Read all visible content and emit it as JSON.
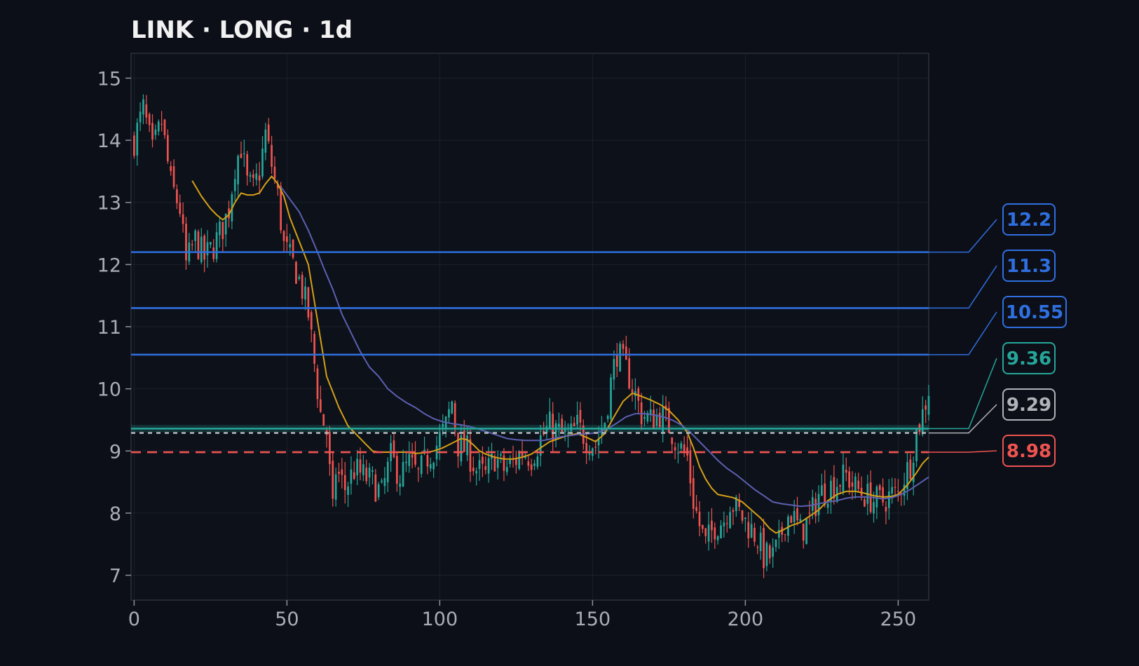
{
  "chart_data": {
    "type": "candlestick",
    "title": "LINK · LONG · 1d",
    "xlim": [
      -1,
      260
    ],
    "ylim": [
      6.6,
      15.4
    ],
    "x_ticks": [
      0,
      50,
      100,
      150,
      200,
      250
    ],
    "y_ticks": [
      7,
      8,
      9,
      10,
      11,
      12,
      13,
      14,
      15
    ],
    "grid": true,
    "colors": {
      "background": "#0c0f17",
      "plot_bg": "#0d1119",
      "up": "#26a69a",
      "down": "#ef5350",
      "ma_fast": "#d4a017",
      "ma_slow": "#5c5fb0",
      "target": "#2f6fe0",
      "entry": "#26a69a",
      "current": "#b0b3b8",
      "stop": "#ef5350"
    },
    "series": [
      {
        "name": "price",
        "close_path": [
          [
            0,
            14.0
          ],
          [
            3,
            14.5
          ],
          [
            6,
            13.8
          ],
          [
            9,
            14.3
          ],
          [
            12,
            13.3
          ],
          [
            15,
            12.9
          ],
          [
            17,
            12.0
          ],
          [
            20,
            12.4
          ],
          [
            23,
            12.1
          ],
          [
            26,
            12.3
          ],
          [
            29,
            12.6
          ],
          [
            31,
            12.9
          ],
          [
            33,
            13.6
          ],
          [
            35,
            13.9
          ],
          [
            37,
            13.3
          ],
          [
            39,
            13.2
          ],
          [
            41,
            13.5
          ],
          [
            43,
            14.1
          ],
          [
            45,
            13.6
          ],
          [
            47,
            13.1
          ],
          [
            49,
            12.3
          ],
          [
            51,
            12.1
          ],
          [
            53,
            11.9
          ],
          [
            55,
            11.6
          ],
          [
            57,
            11.2
          ],
          [
            59,
            10.4
          ],
          [
            61,
            9.6
          ],
          [
            63,
            9.3
          ],
          [
            65,
            8.0
          ],
          [
            66,
            8.7
          ],
          [
            69,
            8.4
          ],
          [
            72,
            8.7
          ],
          [
            75,
            8.6
          ],
          [
            78,
            8.5
          ],
          [
            81,
            8.3
          ],
          [
            84,
            8.9
          ],
          [
            87,
            8.6
          ],
          [
            90,
            8.8
          ],
          [
            93,
            8.6
          ],
          [
            96,
            8.9
          ],
          [
            99,
            9.1
          ],
          [
            102,
            9.4
          ],
          [
            104,
            9.8
          ],
          [
            106,
            9.1
          ],
          [
            109,
            9.0
          ],
          [
            112,
            8.7
          ],
          [
            115,
            8.6
          ],
          [
            118,
            8.9
          ],
          [
            121,
            8.7
          ],
          [
            124,
            8.8
          ],
          [
            127,
            9.0
          ],
          [
            130,
            8.9
          ],
          [
            133,
            9.2
          ],
          [
            136,
            9.4
          ],
          [
            139,
            9.3
          ],
          [
            142,
            9.2
          ],
          [
            145,
            9.4
          ],
          [
            148,
            9.2
          ],
          [
            151,
            9.1
          ],
          [
            154,
            9.5
          ],
          [
            156,
            10.1
          ],
          [
            158,
            10.6
          ],
          [
            160,
            10.4
          ],
          [
            162,
            10.2
          ],
          [
            164,
            9.9
          ],
          [
            166,
            9.6
          ],
          [
            169,
            9.5
          ],
          [
            172,
            9.6
          ],
          [
            175,
            9.4
          ],
          [
            178,
            9.1
          ],
          [
            181,
            8.9
          ],
          [
            183,
            8.2
          ],
          [
            185,
            7.8
          ],
          [
            187,
            7.5
          ],
          [
            190,
            7.8
          ],
          [
            193,
            7.9
          ],
          [
            195,
            8.2
          ],
          [
            198,
            8.0
          ],
          [
            201,
            7.8
          ],
          [
            204,
            7.6
          ],
          [
            206,
            7.3
          ],
          [
            209,
            7.3
          ],
          [
            211,
            7.5
          ],
          [
            213,
            7.9
          ],
          [
            215,
            8.0
          ],
          [
            218,
            7.7
          ],
          [
            221,
            7.9
          ],
          [
            224,
            8.3
          ],
          [
            227,
            8.4
          ],
          [
            230,
            8.5
          ],
          [
            233,
            8.6
          ],
          [
            236,
            8.4
          ],
          [
            239,
            8.3
          ],
          [
            242,
            8.2
          ],
          [
            245,
            8.2
          ],
          [
            248,
            8.3
          ],
          [
            250,
            8.3
          ],
          [
            252,
            8.6
          ],
          [
            254,
            8.8
          ],
          [
            256,
            9.3
          ],
          [
            258,
            9.6
          ],
          [
            260,
            10.0
          ]
        ]
      },
      {
        "name": "ma_fast",
        "points": [
          [
            19,
            13.35
          ],
          [
            22,
            13.1
          ],
          [
            25,
            12.9
          ],
          [
            27,
            12.8
          ],
          [
            29,
            12.72
          ],
          [
            31,
            12.8
          ],
          [
            33,
            13.0
          ],
          [
            35,
            13.15
          ],
          [
            37,
            13.12
          ],
          [
            39,
            13.12
          ],
          [
            41,
            13.15
          ],
          [
            43,
            13.3
          ],
          [
            45,
            13.42
          ],
          [
            47,
            13.3
          ],
          [
            49,
            13.1
          ],
          [
            51,
            12.75
          ],
          [
            53,
            12.5
          ],
          [
            55,
            12.25
          ],
          [
            57,
            12.0
          ],
          [
            59,
            11.4
          ],
          [
            61,
            10.8
          ],
          [
            63,
            10.2
          ],
          [
            65,
            9.95
          ],
          [
            67,
            9.7
          ],
          [
            70,
            9.4
          ],
          [
            73,
            9.25
          ],
          [
            76,
            9.1
          ],
          [
            78,
            9.0
          ],
          [
            80,
            8.98
          ],
          [
            83,
            8.98
          ],
          [
            86,
            8.98
          ],
          [
            89,
            8.98
          ],
          [
            92,
            8.96
          ],
          [
            95,
            8.97
          ],
          [
            98,
            9.0
          ],
          [
            101,
            9.05
          ],
          [
            103,
            9.1
          ],
          [
            105,
            9.15
          ],
          [
            107,
            9.2
          ],
          [
            109,
            9.18
          ],
          [
            111,
            9.1
          ],
          [
            113,
            9.0
          ],
          [
            115,
            8.95
          ],
          [
            118,
            8.9
          ],
          [
            121,
            8.87
          ],
          [
            124,
            8.87
          ],
          [
            127,
            8.9
          ],
          [
            130,
            8.95
          ],
          [
            133,
            9.05
          ],
          [
            136,
            9.15
          ],
          [
            139,
            9.2
          ],
          [
            142,
            9.25
          ],
          [
            145,
            9.28
          ],
          [
            148,
            9.22
          ],
          [
            151,
            9.15
          ],
          [
            154,
            9.28
          ],
          [
            157,
            9.55
          ],
          [
            160,
            9.8
          ],
          [
            163,
            9.93
          ],
          [
            166,
            9.88
          ],
          [
            169,
            9.82
          ],
          [
            172,
            9.75
          ],
          [
            175,
            9.65
          ],
          [
            178,
            9.5
          ],
          [
            181,
            9.3
          ],
          [
            183,
            9.05
          ],
          [
            185,
            8.75
          ],
          [
            187,
            8.55
          ],
          [
            189,
            8.4
          ],
          [
            191,
            8.3
          ],
          [
            193,
            8.28
          ],
          [
            196,
            8.25
          ],
          [
            199,
            8.18
          ],
          [
            202,
            8.05
          ],
          [
            205,
            7.92
          ],
          [
            208,
            7.75
          ],
          [
            210,
            7.68
          ],
          [
            212,
            7.72
          ],
          [
            215,
            7.8
          ],
          [
            218,
            7.85
          ],
          [
            221,
            7.95
          ],
          [
            224,
            8.05
          ],
          [
            227,
            8.2
          ],
          [
            230,
            8.3
          ],
          [
            233,
            8.35
          ],
          [
            236,
            8.35
          ],
          [
            239,
            8.32
          ],
          [
            242,
            8.28
          ],
          [
            245,
            8.26
          ],
          [
            248,
            8.27
          ],
          [
            250,
            8.3
          ],
          [
            253,
            8.45
          ],
          [
            256,
            8.65
          ],
          [
            258,
            8.8
          ],
          [
            260,
            8.9
          ]
        ]
      },
      {
        "name": "ma_slow",
        "points": [
          [
            48,
            13.25
          ],
          [
            51,
            13.05
          ],
          [
            54,
            12.85
          ],
          [
            57,
            12.55
          ],
          [
            60,
            12.2
          ],
          [
            62,
            11.95
          ],
          [
            65,
            11.6
          ],
          [
            68,
            11.2
          ],
          [
            71,
            10.9
          ],
          [
            74,
            10.6
          ],
          [
            77,
            10.35
          ],
          [
            80,
            10.2
          ],
          [
            83,
            10.0
          ],
          [
            86,
            9.88
          ],
          [
            89,
            9.78
          ],
          [
            92,
            9.7
          ],
          [
            95,
            9.6
          ],
          [
            98,
            9.52
          ],
          [
            101,
            9.47
          ],
          [
            104,
            9.44
          ],
          [
            107,
            9.42
          ],
          [
            110,
            9.39
          ],
          [
            113,
            9.35
          ],
          [
            116,
            9.3
          ],
          [
            119,
            9.25
          ],
          [
            122,
            9.2
          ],
          [
            125,
            9.18
          ],
          [
            128,
            9.17
          ],
          [
            131,
            9.17
          ],
          [
            134,
            9.17
          ],
          [
            137,
            9.2
          ],
          [
            140,
            9.23
          ],
          [
            143,
            9.25
          ],
          [
            146,
            9.27
          ],
          [
            149,
            9.28
          ],
          [
            152,
            9.3
          ],
          [
            155,
            9.36
          ],
          [
            158,
            9.45
          ],
          [
            161,
            9.55
          ],
          [
            164,
            9.6
          ],
          [
            167,
            9.6
          ],
          [
            170,
            9.58
          ],
          [
            173,
            9.55
          ],
          [
            176,
            9.5
          ],
          [
            179,
            9.42
          ],
          [
            182,
            9.3
          ],
          [
            185,
            9.15
          ],
          [
            188,
            9.0
          ],
          [
            191,
            8.85
          ],
          [
            194,
            8.72
          ],
          [
            197,
            8.62
          ],
          [
            200,
            8.5
          ],
          [
            203,
            8.38
          ],
          [
            206,
            8.28
          ],
          [
            209,
            8.18
          ],
          [
            212,
            8.15
          ],
          [
            215,
            8.13
          ],
          [
            218,
            8.11
          ],
          [
            221,
            8.12
          ],
          [
            224,
            8.15
          ],
          [
            227,
            8.18
          ],
          [
            230,
            8.2
          ],
          [
            233,
            8.24
          ],
          [
            236,
            8.26
          ],
          [
            239,
            8.26
          ],
          [
            242,
            8.25
          ],
          [
            245,
            8.23
          ],
          [
            248,
            8.25
          ],
          [
            251,
            8.3
          ],
          [
            254,
            8.38
          ],
          [
            257,
            8.48
          ],
          [
            260,
            8.58
          ]
        ]
      }
    ],
    "levels": [
      {
        "value": 12.2,
        "label": "12.2",
        "role": "target",
        "style": "solid"
      },
      {
        "value": 11.3,
        "label": "11.3",
        "role": "target",
        "style": "solid"
      },
      {
        "value": 10.55,
        "label": "10.55",
        "role": "target",
        "style": "solid"
      },
      {
        "value": 9.36,
        "label": "9.36",
        "role": "entry",
        "style": "solid"
      },
      {
        "value": 9.29,
        "label": "9.29",
        "role": "current",
        "style": "dotted"
      },
      {
        "value": 8.98,
        "label": "8.98",
        "role": "stop",
        "style": "dashed"
      }
    ],
    "entry_zone": [
      9.3,
      9.42
    ]
  }
}
